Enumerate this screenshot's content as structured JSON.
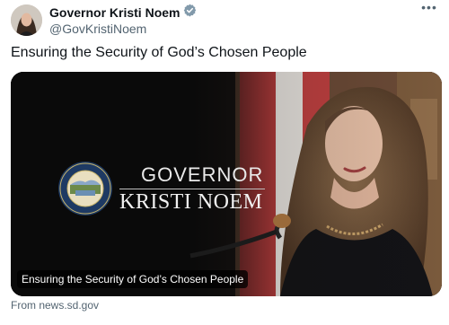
{
  "tweet": {
    "display_name": "Governor Kristi Noem",
    "handle": "@GovKristiNoem",
    "text": "Ensuring the Security of God’s Chosen People",
    "more_icon": "more-horizontal-icon",
    "verified_icon": "verified-badge-icon"
  },
  "card": {
    "title_line1": "GOVERNOR",
    "title_line2": "KRISTI NOEM",
    "caption": "Ensuring the Security of God’s Chosen People",
    "seal_icon": "state-seal-icon",
    "source": "From news.sd.gov"
  },
  "colors": {
    "verified_badge": "#829aab",
    "muted_text": "#536471",
    "primary_text": "#0f1419"
  }
}
